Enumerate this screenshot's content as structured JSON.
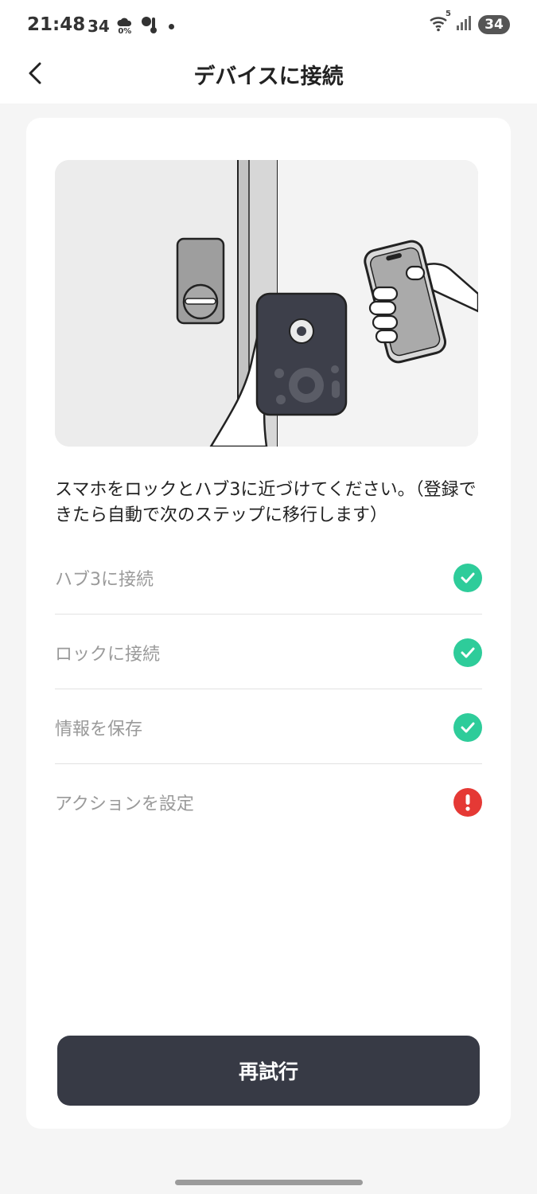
{
  "status_bar": {
    "time": "21:48",
    "temperature": "34",
    "precip": "0%",
    "network": "5",
    "battery": "34"
  },
  "header": {
    "title": "デバイスに接続",
    "back_icon": "chevron-left-icon"
  },
  "instruction": "スマホをロックとハブ3に近づけてください。（登録できたら自動で次のステップに移行します）",
  "steps": [
    {
      "label": "ハブ3に接続",
      "status": "done"
    },
    {
      "label": "ロックに接続",
      "status": "done"
    },
    {
      "label": "情報を保存",
      "status": "done"
    },
    {
      "label": "アクションを設定",
      "status": "error"
    }
  ],
  "retry_button": "再試行",
  "colors": {
    "success": "#2ecc9a",
    "error": "#e53935",
    "button_bg": "#373a45"
  }
}
